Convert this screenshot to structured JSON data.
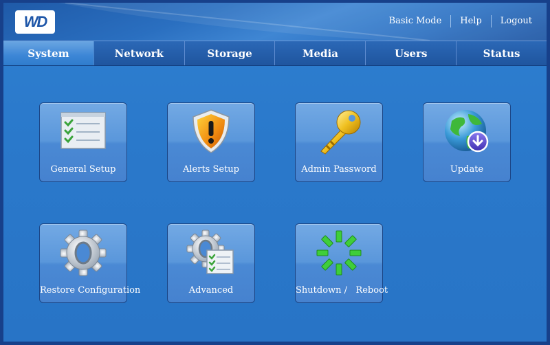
{
  "header": {
    "logo_text": "WD",
    "links": [
      "Basic Mode",
      "Help",
      "Logout"
    ]
  },
  "tabs": [
    {
      "label": "System",
      "active": true
    },
    {
      "label": "Network",
      "active": false
    },
    {
      "label": "Storage",
      "active": false
    },
    {
      "label": "Media",
      "active": false
    },
    {
      "label": "Users",
      "active": false
    },
    {
      "label": "Status",
      "active": false
    }
  ],
  "tiles": [
    {
      "label": "General Setup",
      "icon": "checklist-icon"
    },
    {
      "label": "Alerts Setup",
      "icon": "warning-shield-icon"
    },
    {
      "label": "Admin Password",
      "icon": "key-icon"
    },
    {
      "label": "Update",
      "icon": "globe-download-icon"
    },
    {
      "label": "Restore Configuration",
      "icon": "gear-icon"
    },
    {
      "label": "Advanced",
      "icon": "gear-checklist-icon"
    },
    {
      "label": "Shutdown /   Reboot",
      "icon": "power-spinner-icon"
    }
  ],
  "colors": {
    "background": "#2a79cb",
    "tab_bar": "#2460ad",
    "active_tab": "#4a8fdc",
    "tile": "#5a97db"
  }
}
